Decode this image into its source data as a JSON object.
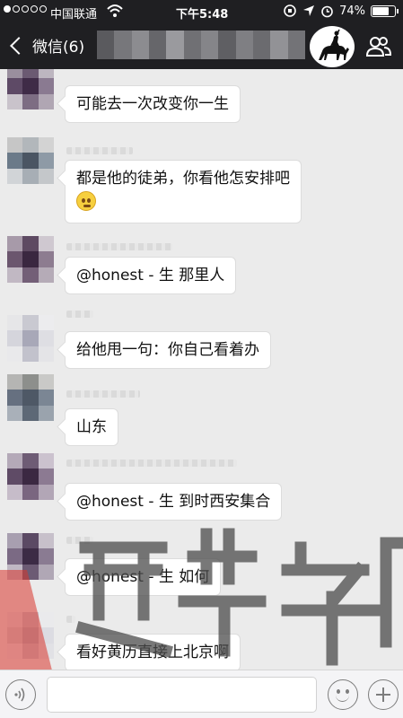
{
  "status_bar": {
    "carrier": "中国联通",
    "time": "下午5:48",
    "battery": "74%",
    "battery_level": 0.74,
    "signal_bars_filled": 1,
    "signal_bars_total": 5
  },
  "nav": {
    "back_label": "微信(6)",
    "title_obscured": true,
    "icons": [
      "back-chevron-icon",
      "group-avatar-rider-icon",
      "people-icon"
    ]
  },
  "messages": [
    {
      "text": "可能去一次改变你一生",
      "avatar_palette": [
        "#9a8f9e",
        "#6b5a72",
        "#bdb6c0",
        "#5e4a66",
        "#3f2b47",
        "#8a7a91",
        "#c9c3cb",
        "#7d6d83",
        "#b0a6b3"
      ]
    },
    {
      "text": "都是他的徒弟，你看他怎安排吧",
      "emoji": "smiley-emoji",
      "avatar_palette": [
        "#c6c6c6",
        "#b2b7bb",
        "#d3d3d3",
        "#6b7a89",
        "#4a5563",
        "#8e9aa6",
        "#d1d4d7",
        "#a7aeb5",
        "#c4c7ca"
      ]
    },
    {
      "text": "@honest - 生  那里人",
      "avatar_palette": [
        "#a79aa9",
        "#5e4a62",
        "#cfc8d0",
        "#6b566e",
        "#3a2740",
        "#8d7c90",
        "#c1b8c3",
        "#735f77",
        "#b5abb7"
      ]
    },
    {
      "text": "给他甩一句：你自己看着办",
      "avatar_palette": [
        "#e6e6e8",
        "#c9c9d1",
        "#ececee",
        "#d5d5dc",
        "#a8a8b8",
        "#dedee3",
        "#e9e9eb",
        "#c2c2cc",
        "#e4e4e7"
      ]
    },
    {
      "text": "山东",
      "avatar_palette": [
        "#b5b5b3",
        "#8d8f8c",
        "#c9c9c7",
        "#667080",
        "#4e5866",
        "#7b8694",
        "#a9b0b9",
        "#5d6876",
        "#9aa3ad"
      ]
    },
    {
      "text": "@honest - 生  到时西安集合",
      "avatar_palette": [
        "#b4a9b8",
        "#6e5c75",
        "#cbc2ce",
        "#5f4b66",
        "#3b2842",
        "#8c7a92",
        "#c6bcc9",
        "#7a6680",
        "#b2a6b6"
      ]
    },
    {
      "text": "@honest - 生  如何",
      "avatar_palette": [
        "#a89fb0",
        "#5b4a64",
        "#c7c0ca",
        "#7b6a84",
        "#3c2b45",
        "#8a7b92",
        "#bfb7c3",
        "#6c5b74",
        "#b0a7b5"
      ]
    },
    {
      "text": "看好黄历直接上北京啊",
      "avatar_palette": [
        "#e3e3e6",
        "#c8c8d0",
        "#eaeaec",
        "#d2d2d8",
        "#b5b5c2",
        "#dcdce2",
        "#e7e7ea",
        "#cbcbd3",
        "#e1e1e5"
      ]
    }
  ],
  "input": {
    "placeholder": "",
    "icons": [
      "voice-icon",
      "emoji-icon",
      "plus-icon"
    ]
  },
  "colors": {
    "bar_bg": "#1f1f22",
    "chat_bg": "#ebebeb",
    "bubble_bg": "#ffffff",
    "watermark_red": "#d9342b",
    "watermark_gray": "#4b4b4b"
  }
}
